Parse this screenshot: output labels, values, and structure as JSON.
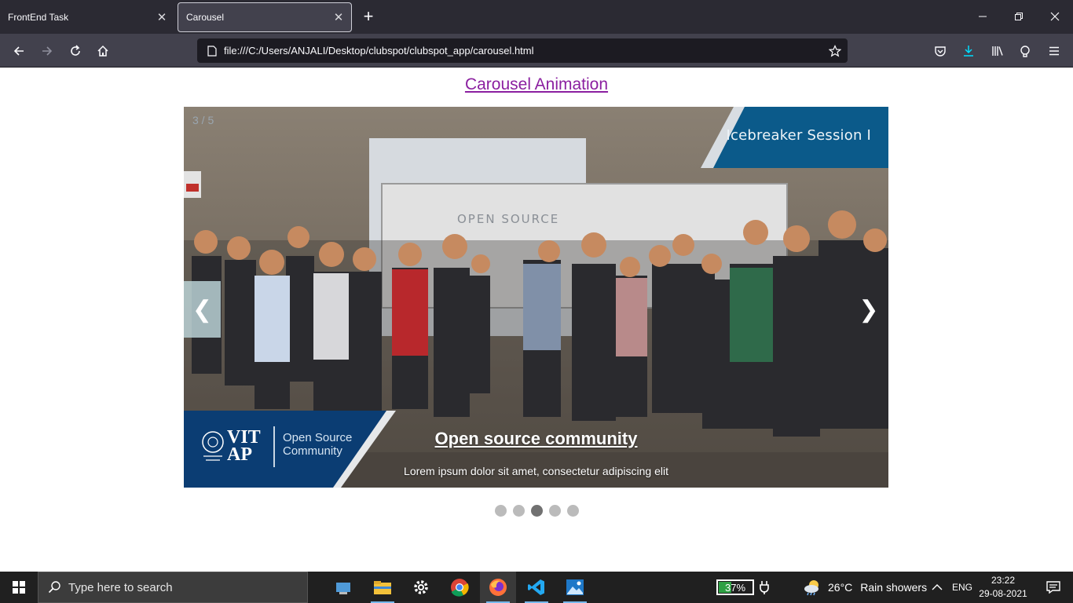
{
  "browser": {
    "tabs": [
      {
        "title": "FrontEnd Task",
        "active": false
      },
      {
        "title": "Carousel",
        "active": true
      }
    ],
    "url": "file:///C:/Users/ANJALI/Desktop/clubspot/clubspot_app/carousel.html"
  },
  "page": {
    "title": "Carousel Animation",
    "carousel": {
      "slide_counter": "3 / 5",
      "banner_text": "Icebreaker Session I",
      "logo_vit": "VIT AP",
      "logo_osc_line1": "Open Source",
      "logo_osc_line2": "Community",
      "prev_label": "❮",
      "next_label": "❯",
      "caption_title": "Open source community",
      "caption_text": "Lorem ipsum dolor sit amet, consectetur adipiscing elit",
      "total_slides": 5,
      "active_slide": 3
    }
  },
  "taskbar": {
    "search_placeholder": "Type here to search",
    "battery": "37%",
    "battery_level": 0.37,
    "weather_temp": "26°C",
    "weather_text": "Rain showers",
    "language": "ENG",
    "time": "23:22",
    "date": "29-08-2021"
  }
}
